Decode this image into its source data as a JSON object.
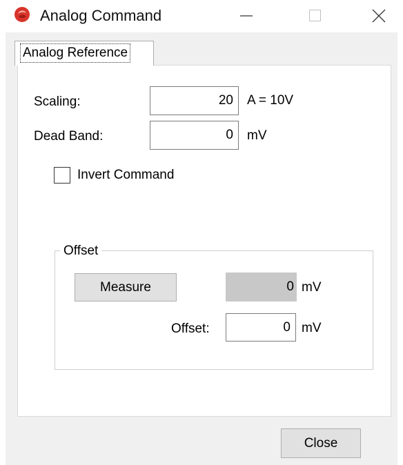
{
  "window": {
    "title": "Analog Command",
    "controls": {
      "minimize": "minimize-icon",
      "maximize": "maximize-icon",
      "close": "close-icon"
    }
  },
  "tabs": [
    {
      "label": "Analog Reference",
      "active": true
    }
  ],
  "scaling": {
    "label": "Scaling:",
    "value": "20",
    "unit": "A = 10V"
  },
  "dead_band": {
    "label": "Dead Band:",
    "value": "0",
    "unit": "mV"
  },
  "invert_command": {
    "label": "Invert Command",
    "checked": false
  },
  "offset_group": {
    "title": "Offset",
    "measure_button": "Measure",
    "measured_value": "0",
    "measured_unit": "mV",
    "offset_label": "Offset:",
    "offset_value": "0",
    "offset_unit": "mV"
  },
  "footer": {
    "close_button": "Close"
  },
  "colors": {
    "app_icon": "#d9342b",
    "dialog_bg": "#f0f0f0",
    "readout_bg": "#c8c8c8",
    "button_bg": "#e1e1e1"
  }
}
